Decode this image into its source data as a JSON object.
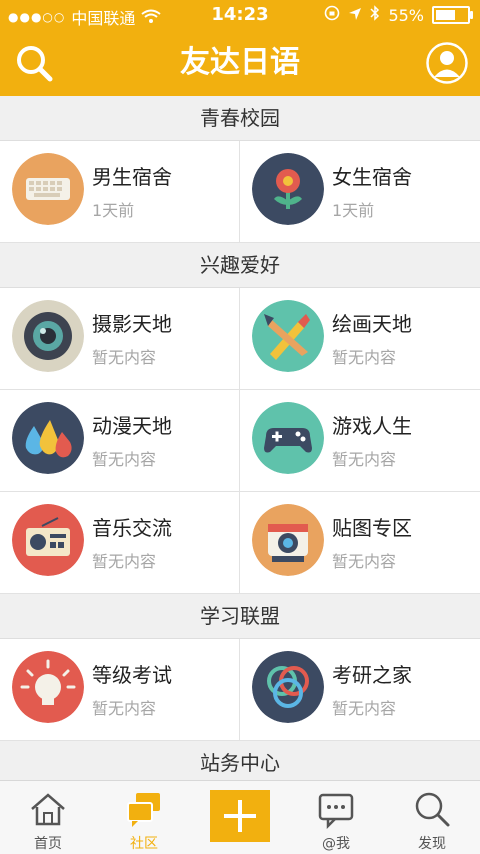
{
  "status": {
    "carrier": "中国联通",
    "time": "14:23",
    "battery": "55%",
    "battery_level": 0.55
  },
  "nav": {
    "title": "友达日语"
  },
  "sections": [
    {
      "title": "青春校园",
      "items": [
        {
          "name": "男生宿舍",
          "meta": "1天前",
          "icon": "keyboard-icon"
        },
        {
          "name": "女生宿舍",
          "meta": "1天前",
          "icon": "flower-icon"
        }
      ]
    },
    {
      "title": "兴趣爱好",
      "items": [
        {
          "name": "摄影天地",
          "meta": "暂无内容",
          "icon": "camera-lens-icon"
        },
        {
          "name": "绘画天地",
          "meta": "暂无内容",
          "icon": "paint-brush-icon"
        },
        {
          "name": "动漫天地",
          "meta": "暂无内容",
          "icon": "ink-drops-icon"
        },
        {
          "name": "游戏人生",
          "meta": "暂无内容",
          "icon": "gamepad-icon"
        },
        {
          "name": "音乐交流",
          "meta": "暂无内容",
          "icon": "radio-icon"
        },
        {
          "name": "贴图专区",
          "meta": "暂无内容",
          "icon": "instant-camera-icon"
        }
      ]
    },
    {
      "title": "学习联盟",
      "items": [
        {
          "name": "等级考试",
          "meta": "暂无内容",
          "icon": "lightbulb-icon"
        },
        {
          "name": "考研之家",
          "meta": "暂无内容",
          "icon": "rings-icon"
        }
      ]
    },
    {
      "title": "站务中心",
      "items": []
    }
  ],
  "tabs": [
    {
      "label": "首页",
      "icon": "home-icon",
      "active": false
    },
    {
      "label": "社区",
      "icon": "community-icon",
      "active": true
    },
    {
      "label": "@我",
      "icon": "mention-chat-icon",
      "active": false
    },
    {
      "label": "发现",
      "icon": "discover-search-icon",
      "active": false
    }
  ],
  "colors": {
    "accent": "#f2b00f"
  }
}
